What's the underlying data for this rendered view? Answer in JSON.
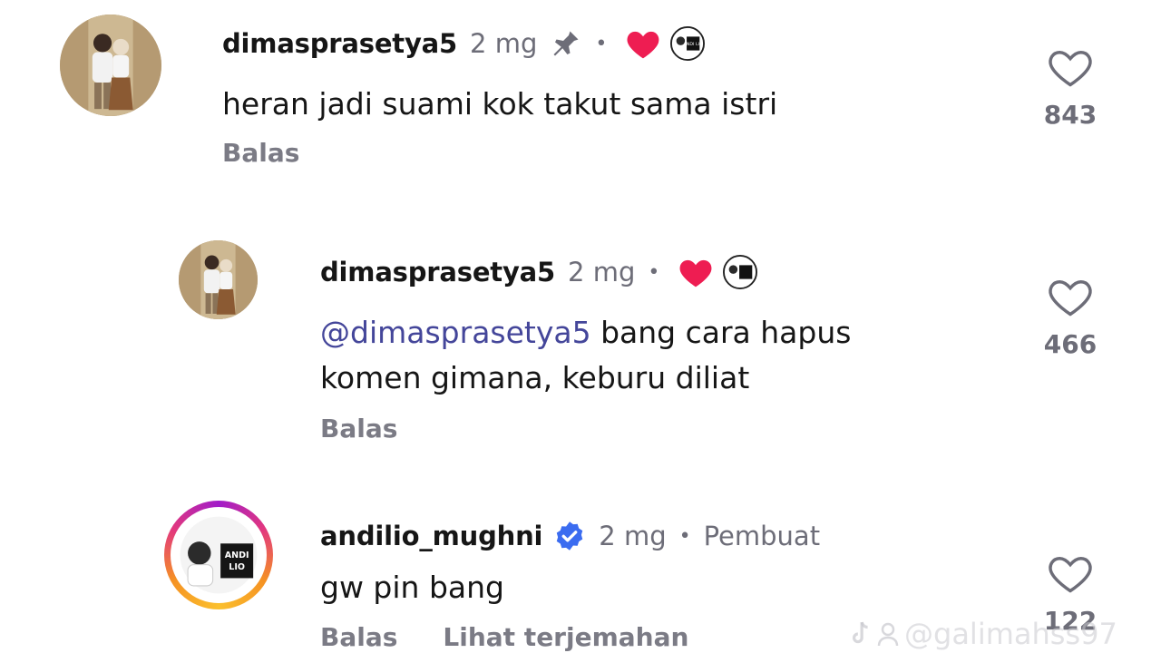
{
  "comments": [
    {
      "username": "dimasprasetya5",
      "time": "2 mg",
      "pinned": true,
      "separator": "•",
      "text": "heran jadi suami kok takut sama istri",
      "reply_label": "Balas",
      "like_count": "843"
    },
    {
      "username": "dimasprasetya5",
      "time": "2 mg",
      "separator": "•",
      "mention": "@dimasprasetya5",
      "text_line1": " bang cara hapus",
      "text_line2": "komen gimana, keburu diliat",
      "reply_label": "Balas",
      "like_count": "466"
    },
    {
      "username": "andilio_mughni",
      "verified": true,
      "time": "2 mg",
      "separator": "•",
      "creator_label": "Pembuat",
      "text": "gw pin bang",
      "reply_label": "Balas",
      "translate_label": "Lihat terjemahan",
      "like_count": "122"
    }
  ],
  "avatar_badge_text": "ANDI LIO",
  "watermark": "@galimahss97",
  "colors": {
    "heart": "#ee1d52",
    "verified": "#3b6cf0",
    "mention": "#44469a",
    "secondary_text": "#6d6d78"
  },
  "icons": [
    "pin-icon",
    "heart-filled-icon",
    "creator-avatar-icon",
    "verified-icon",
    "heart-outline-icon",
    "tiktok-logo-icon",
    "user-icon"
  ]
}
